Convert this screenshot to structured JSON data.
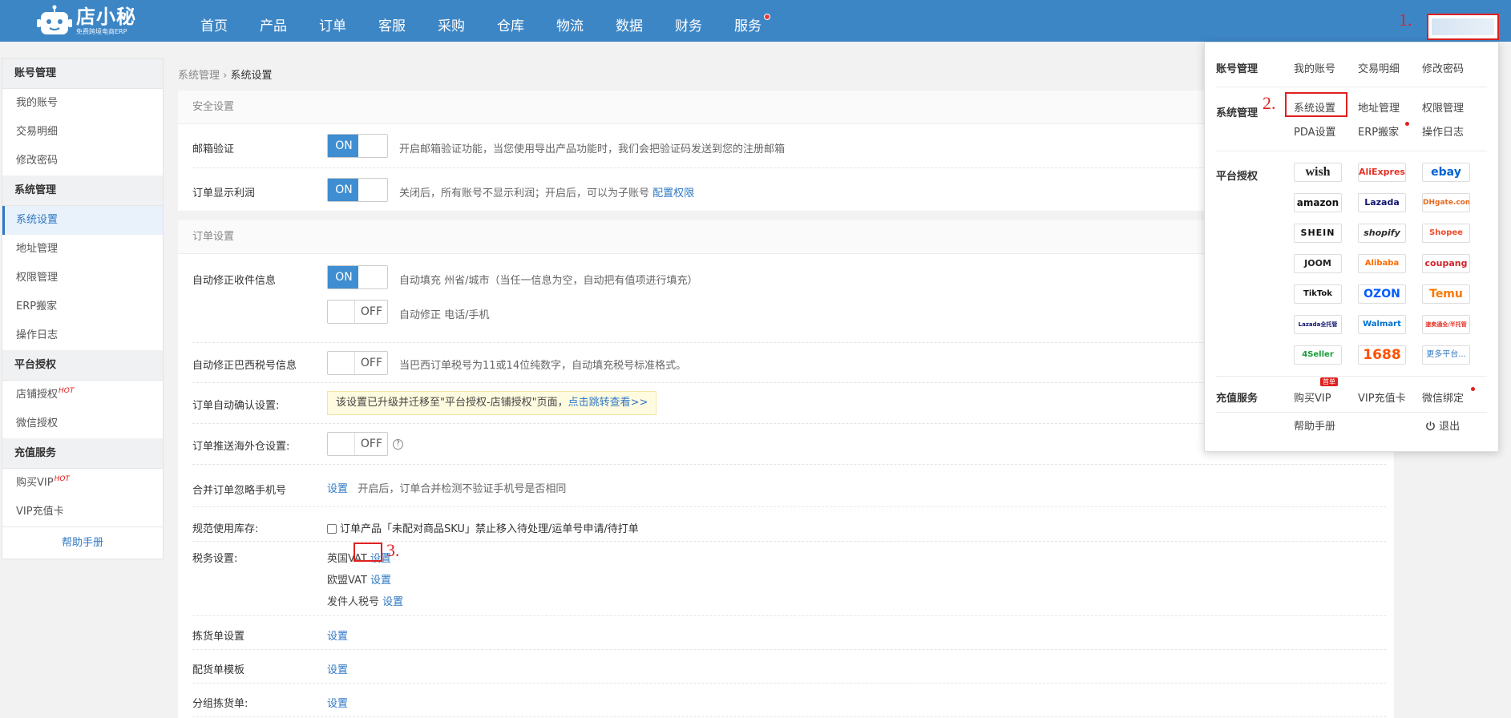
{
  "brand": {
    "name": "店小秘",
    "tagline": "免费跨境电商ERP"
  },
  "nav": [
    {
      "label": "首页"
    },
    {
      "label": "产品"
    },
    {
      "label": "订单"
    },
    {
      "label": "客服"
    },
    {
      "label": "采购"
    },
    {
      "label": "仓库"
    },
    {
      "label": "物流"
    },
    {
      "label": "数据"
    },
    {
      "label": "财务"
    },
    {
      "label": "服务"
    }
  ],
  "annotations": {
    "step1": "1.",
    "step2": "2.",
    "step3": "3."
  },
  "sidebar": {
    "groups": [
      {
        "title": "账号管理",
        "items": [
          "我的账号",
          "交易明细",
          "修改密码"
        ]
      },
      {
        "title": "系统管理",
        "items": [
          "系统设置",
          "地址管理",
          "权限管理",
          "ERP搬家",
          "操作日志"
        ]
      },
      {
        "title": "平台授权",
        "items": [
          "店铺授权",
          "微信授权"
        ]
      },
      {
        "title": "充值服务",
        "items": [
          "购买VIP",
          "VIP充值卡"
        ]
      }
    ],
    "hot": "HOT",
    "help": "帮助手册"
  },
  "breadcrumb": {
    "parent": "系统管理",
    "sep": "›",
    "current": "系统设置"
  },
  "security": {
    "title": "安全设置",
    "email": {
      "label": "邮箱验证",
      "state": "ON",
      "desc": "开启邮箱验证功能，当您使用导出产品功能时，我们会把验证码发送到您的注册邮箱"
    },
    "profit": {
      "label": "订单显示利润",
      "state": "ON",
      "desc": "关闭后，所有账号不显示利润；开启后，可以为子账号",
      "link": "配置权限"
    }
  },
  "order": {
    "title": "订单设置",
    "autofix": {
      "label": "自动修正收件信息",
      "state1": "ON",
      "desc1": "自动填充 州省/城市（当任一信息为空，自动把有值项进行填充）",
      "state2": "OFF",
      "desc2": "自动修正 电话/手机"
    },
    "brazil": {
      "label": "自动修正巴西税号信息",
      "state": "OFF",
      "desc": "当巴西订单税号为11或14位纯数字，自动填充税号标准格式。"
    },
    "autoconfirm": {
      "label": "订单自动确认设置:",
      "notice": "该设置已升级并迁移至\"平台授权-店铺授权\"页面，",
      "notice_link": "点击跳转查看>>"
    },
    "overseas": {
      "label": "订单推送海外仓设置:",
      "state": "OFF",
      "help": "?"
    },
    "merge": {
      "label": "合并订单忽略手机号",
      "link": "设置",
      "desc": "开启后，订单合并检测不验证手机号是否相同"
    },
    "stock": {
      "label": "规范使用库存:",
      "desc": "订单产品「未配对商品SKU」禁止移入待处理/运单号申请/待打单"
    },
    "tax": {
      "label": "税务设置:",
      "items": [
        {
          "name": "英国VAT",
          "link": "设置"
        },
        {
          "name": "欧盟VAT",
          "link": "设置"
        },
        {
          "name": "发件人税号",
          "link": "设置"
        }
      ]
    },
    "picking": {
      "label": "拣货单设置",
      "link": "设置"
    },
    "packing": {
      "label": "配货单模板",
      "link": "设置"
    },
    "group_picking": {
      "label": "分组拣货单:",
      "link": "设置"
    }
  },
  "dropdown": {
    "account": {
      "label": "账号管理",
      "links": [
        "我的账号",
        "交易明细",
        "修改密码"
      ]
    },
    "system": {
      "label": "系统管理",
      "links": [
        "系统设置",
        "地址管理",
        "权限管理",
        "PDA设置",
        "ERP搬家",
        "操作日志"
      ]
    },
    "platform": {
      "label": "平台授权",
      "platforms": [
        "wish",
        "AliExpress",
        "ebay",
        "amazon",
        "Lazada",
        "DHgate.com",
        "SHEIN",
        "shopify",
        "Shopee",
        "JOOM",
        "Alibaba",
        "coupang",
        "TikTok",
        "OZON",
        "Temu",
        "Lazada全托管",
        "Walmart",
        "速卖通全/半托管",
        "4Seller",
        "1688",
        "更多平台..."
      ]
    },
    "recharge": {
      "label": "充值服务",
      "links": [
        "购买VIP",
        "VIP充值卡",
        "微信绑定"
      ],
      "vip_tag": "首单"
    },
    "help": "帮助手册",
    "logout": "退出"
  },
  "colors": {
    "topbar": "#3d86c6",
    "accent": "#2f78c4",
    "toggle_on": "#3f8ed1",
    "annotation": "#e02020"
  }
}
